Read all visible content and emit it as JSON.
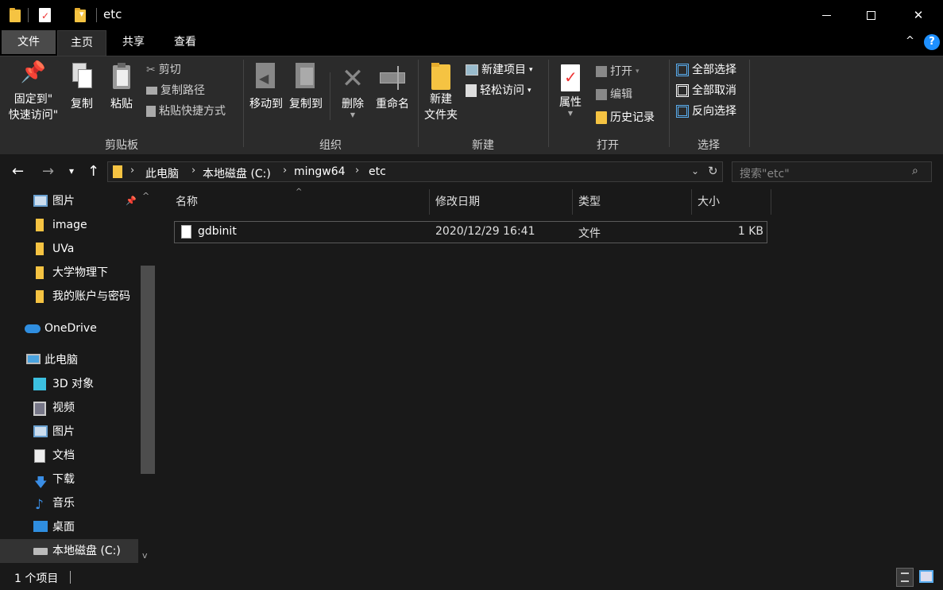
{
  "window": {
    "title": "etc",
    "minimize": "—",
    "maximize": "☐",
    "close": "✕"
  },
  "tabs": [
    "文件",
    "主页",
    "共享",
    "查看"
  ],
  "ribbon": {
    "clipboard": {
      "pin_line1": "固定到\"",
      "pin_line2": "快速访问\"",
      "copy": "复制",
      "paste": "粘贴",
      "cut": "剪切",
      "copy_path": "复制路径",
      "paste_shortcut": "粘贴快捷方式",
      "label": "剪贴板"
    },
    "organize": {
      "move_to": "移动到",
      "copy_to": "复制到",
      "delete": "删除",
      "rename": "重命名",
      "label": "组织"
    },
    "new": {
      "new_folder_1": "新建",
      "new_folder_2": "文件夹",
      "new_item": "新建项目",
      "easy_access": "轻松访问",
      "label": "新建"
    },
    "open": {
      "properties": "属性",
      "open": "打开",
      "edit": "编辑",
      "history": "历史记录",
      "label": "打开"
    },
    "select": {
      "select_all": "全部选择",
      "select_none": "全部取消",
      "invert": "反向选择",
      "label": "选择"
    }
  },
  "address": {
    "crumbs": [
      "此电脑",
      "本地磁盘 (C:)",
      "mingw64",
      "etc"
    ],
    "search_placeholder": "搜索\"etc\""
  },
  "nav": {
    "quick": [
      "图片",
      "image",
      "UVa",
      "大学物理下",
      "我的账户与密码"
    ],
    "onedrive": "OneDrive",
    "this_pc": "此电脑",
    "pc_items": [
      "3D 对象",
      "视频",
      "图片",
      "文档",
      "下载",
      "音乐",
      "桌面",
      "本地磁盘 (C:)"
    ]
  },
  "columns": {
    "name": "名称",
    "modified": "修改日期",
    "type": "类型",
    "size": "大小"
  },
  "files": [
    {
      "name": "gdbinit",
      "modified": "2020/12/29 16:41",
      "type": "文件",
      "size": "1 KB"
    }
  ],
  "status": {
    "count": "1 个项目"
  },
  "colors": {
    "accent": "#1e90ff",
    "folder": "#f5c342",
    "background": "#191919",
    "ribbon": "#2b2b2b"
  }
}
